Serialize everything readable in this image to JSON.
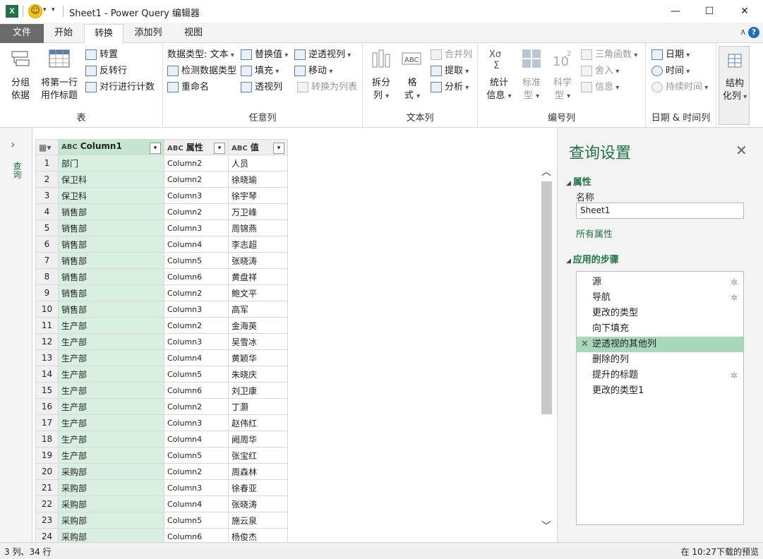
{
  "titlebar": {
    "title": "Sheet1 - Power Query 编辑器",
    "app_icon": "X"
  },
  "tabs": [
    {
      "label": "文件"
    },
    {
      "label": "开始"
    },
    {
      "label": "转换"
    },
    {
      "label": "添加列"
    },
    {
      "label": "视图"
    }
  ],
  "ribbon": {
    "table_group": {
      "label": "表",
      "group_by": "分组\n依据",
      "first_row_header": "将第一行\n用作标题",
      "transpose": "转置",
      "reverse_rows": "反转行",
      "count_rows": "对行进行计数"
    },
    "any_column_group": {
      "label": "任意列",
      "data_type": "数据类型: 文本",
      "detect_type": "检测数据类型",
      "rename": "重命名",
      "replace_values": "替换值",
      "fill": "填充",
      "pivot": "透视列",
      "unpivot": "逆透视列",
      "move": "移动",
      "to_list": "转换为列表"
    },
    "text_column_group": {
      "label": "文本列",
      "split": "拆分\n列",
      "format": "格\n式",
      "merge": "合并列",
      "extract": "提取",
      "parse": "分析"
    },
    "number_column_group": {
      "label": "编号列",
      "statistics": "统计\n信息",
      "standard": "标准\n型",
      "scientific": "科学\n型",
      "trig": "三角函数",
      "rounding": "舍入",
      "information": "信息"
    },
    "datetime_group": {
      "label": "日期 & 时间列",
      "date": "日期",
      "time": "时间",
      "duration": "持续时间"
    },
    "structured": {
      "label": "结构\n化列"
    }
  },
  "leftnav": {
    "label": "查询"
  },
  "table": {
    "headers": [
      {
        "type": "ABC",
        "name": "Column1"
      },
      {
        "type": "ABC",
        "name": "属性"
      },
      {
        "type": "ABC",
        "name": "值"
      }
    ],
    "rows": [
      [
        "1",
        "部门",
        "Column2",
        "人员"
      ],
      [
        "2",
        "保卫科",
        "Column2",
        "徐晓瑜"
      ],
      [
        "3",
        "保卫科",
        "Column3",
        "徐宇琴"
      ],
      [
        "4",
        "销售部",
        "Column2",
        "万卫峰"
      ],
      [
        "5",
        "销售部",
        "Column3",
        "周锦燕"
      ],
      [
        "6",
        "销售部",
        "Column4",
        "李志超"
      ],
      [
        "7",
        "销售部",
        "Column5",
        "张晓涛"
      ],
      [
        "8",
        "销售部",
        "Column6",
        "黄盘祥"
      ],
      [
        "9",
        "销售部",
        "Column2",
        "鲍文平"
      ],
      [
        "10",
        "销售部",
        "Column3",
        "高军"
      ],
      [
        "11",
        "生产部",
        "Column2",
        "金海英"
      ],
      [
        "12",
        "生产部",
        "Column3",
        "吴雪冰"
      ],
      [
        "13",
        "生产部",
        "Column4",
        "黄颖华"
      ],
      [
        "14",
        "生产部",
        "Column5",
        "朱晓庆"
      ],
      [
        "15",
        "生产部",
        "Column6",
        "刘卫康"
      ],
      [
        "16",
        "生产部",
        "Column2",
        "丁灏"
      ],
      [
        "17",
        "生产部",
        "Column3",
        "赵伟红"
      ],
      [
        "18",
        "生产部",
        "Column4",
        "阙周华"
      ],
      [
        "19",
        "生产部",
        "Column5",
        "张宝红"
      ],
      [
        "20",
        "采购部",
        "Column2",
        "周森林"
      ],
      [
        "21",
        "采购部",
        "Column3",
        "徐春亚"
      ],
      [
        "22",
        "采购部",
        "Column4",
        "张晓涛"
      ],
      [
        "23",
        "采购部",
        "Column5",
        "施云泉"
      ],
      [
        "24",
        "采购部",
        "Column6",
        "杨俊杰"
      ]
    ]
  },
  "settings": {
    "title": "查询设置",
    "properties_label": "属性",
    "name_label": "名称",
    "name_value": "Sheet1",
    "all_properties": "所有属性",
    "steps_label": "应用的步骤",
    "steps": [
      {
        "label": "源",
        "gear": true
      },
      {
        "label": "导航",
        "gear": true
      },
      {
        "label": "更改的类型",
        "gear": false
      },
      {
        "label": "向下填充",
        "gear": false
      },
      {
        "label": "逆透视的其他列",
        "gear": false,
        "selected": true
      },
      {
        "label": "删除的列",
        "gear": false
      },
      {
        "label": "提升的标题",
        "gear": true
      },
      {
        "label": "更改的类型1",
        "gear": false
      }
    ]
  },
  "status": {
    "left": "3 列、34 行",
    "right": "在 10:27下载的预览"
  },
  "colors": {
    "accent": "#217346",
    "selected_col": "#d9efe1",
    "selected_step": "#a8d8b9"
  }
}
